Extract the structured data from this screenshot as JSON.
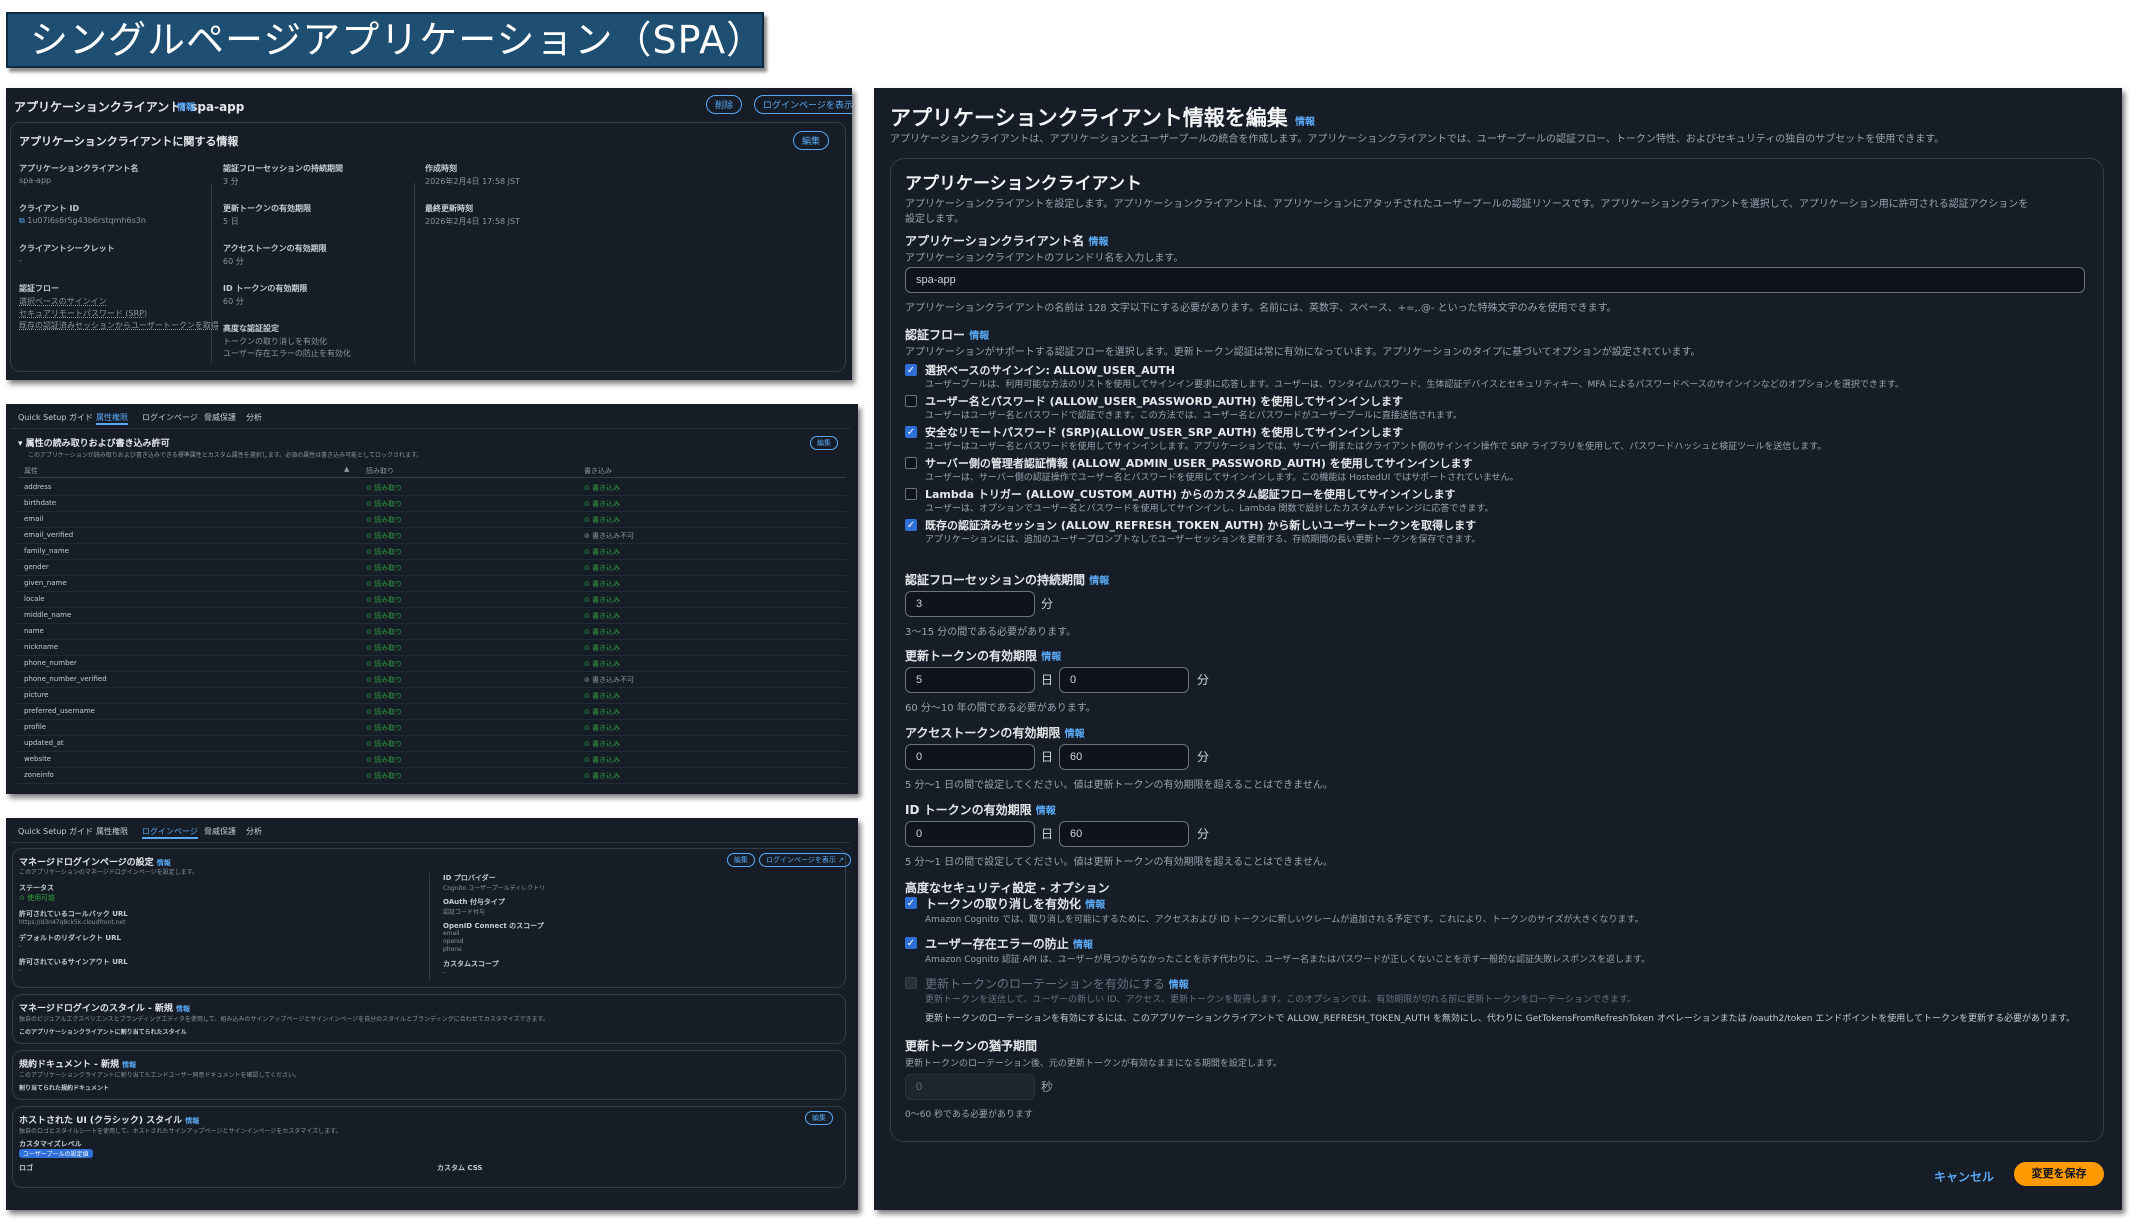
{
  "banner": {
    "title": "シングルページアプリケーション（SPA）"
  },
  "panel1": {
    "header": "アプリケーションクライアント: spa-app",
    "header_info": "情報",
    "delete_button": "削除",
    "view_login_button": "ログインページを表示",
    "section_title": "アプリケーションクライアントに関する情報",
    "edit_button": "編集",
    "col1": [
      {
        "label": "アプリケーションクライアント名",
        "value": "spa-app"
      },
      {
        "label": "クライアント ID",
        "value": "1u07i6s6r5g43b6rstqmh6s3n"
      },
      {
        "label": "クライアントシークレット",
        "value": "-"
      },
      {
        "label": "認証フロー",
        "value": "選択ベースのサインイン"
      },
      {
        "label": "",
        "value": "セキュアリモートパスワード (SRP)"
      },
      {
        "label": "",
        "value": "既存の認証済みセッションからユーザートークンを取得"
      }
    ],
    "col2": [
      {
        "label": "認証フローセッションの持続期間",
        "value": "3 分"
      },
      {
        "label": "更新トークンの有効期限",
        "value": "5 日"
      },
      {
        "label": "アクセストークンの有効期限",
        "value": "60 分"
      },
      {
        "label": "ID トークンの有効期限",
        "value": "60 分"
      },
      {
        "label": "高度な認証設定",
        "value": "トークンの取り消しを有効化"
      },
      {
        "label": "",
        "value": "ユーザー存在エラーの防止を有効化"
      }
    ],
    "col3": [
      {
        "label": "作成時刻",
        "value": "2026年2月4日 17:58 JST"
      },
      {
        "label": "最終更新時刻",
        "value": "2026年2月4日 17:58 JST"
      }
    ]
  },
  "panel2": {
    "tabs": [
      "Quick Setup ガイド",
      "属性権限",
      "ログインページ",
      "脅威保護",
      "分析"
    ],
    "active_tab": 1,
    "section_title": "属性の読み取りおよび書き込み許可",
    "section_desc": "このアプリケーションが読み取りおよび書き込みできる標準属性とカスタム属性を選択します。必須の属性は書き込み可能としてロックされます。",
    "edit_button": "編集",
    "col_headers": [
      "属性",
      "読み取り",
      "書き込み"
    ],
    "rows": [
      [
        "address",
        "読み取り",
        "書き込み"
      ],
      [
        "birthdate",
        "読み取り",
        "書き込み"
      ],
      [
        "email",
        "読み取り",
        "書き込み"
      ],
      [
        "email_verified",
        "読み取り",
        "書き込み不可"
      ],
      [
        "family_name",
        "読み取り",
        "書き込み"
      ],
      [
        "gender",
        "読み取り",
        "書き込み"
      ],
      [
        "given_name",
        "読み取り",
        "書き込み"
      ],
      [
        "locale",
        "読み取り",
        "書き込み"
      ],
      [
        "middle_name",
        "読み取り",
        "書き込み"
      ],
      [
        "name",
        "読み取り",
        "書き込み"
      ],
      [
        "nickname",
        "読み取り",
        "書き込み"
      ],
      [
        "phone_number",
        "読み取り",
        "書き込み"
      ],
      [
        "phone_number_verified",
        "読み取り",
        "書き込み不可"
      ],
      [
        "picture",
        "読み取り",
        "書き込み"
      ],
      [
        "preferred_username",
        "読み取り",
        "書き込み"
      ],
      [
        "profile",
        "読み取り",
        "書き込み"
      ],
      [
        "updated_at",
        "読み取り",
        "書き込み"
      ],
      [
        "website",
        "読み取り",
        "書き込み"
      ],
      [
        "zoneinfo",
        "読み取り",
        "書き込み"
      ]
    ]
  },
  "panel3": {
    "tabs": [
      "Quick Setup ガイド",
      "属性権限",
      "ログインページ",
      "脅威保護",
      "分析"
    ],
    "active_tab": 2,
    "managed_title": "マネージドログインページの設定",
    "managed_desc": "このアプリケーションのマネージドログインページを設定します。",
    "edit_button": "編集",
    "view_login_button": "ログインページを表示",
    "status_label": "ステータス",
    "status_value": "使用可能",
    "idp_label": "ID プロバイダー",
    "idp_value": "Cognito ユーザープールディレクトリ",
    "callback_label": "許可されているコールバック URL",
    "callback_value": "https://d3n47q8ck5k.cloudfront.net",
    "oauth_label": "OAuth 付与タイプ",
    "oauth_value": "認証コード付与",
    "redirect_label": "デフォルトのリダイレクト URL",
    "redirect_value": "-",
    "scopes_label": "OpenID Connect のスコープ",
    "scopes": [
      "email",
      "openid",
      "phone"
    ],
    "signout_label": "許可されているサインアウト URL",
    "signout_value": "-",
    "custom_scope_label": "カスタムスコープ",
    "custom_scope_value": "-",
    "style_title": "マネージドログインのスタイル - 新規",
    "style_desc": "独自のビジュアルエクスペリエンスとブランディングエディタを使用して、組み込みのサインアップページとサインインページを自分のスタイルとブランディングに合わせてカスタマイズできます。",
    "style_note": "このアプリケーションクライアントに割り当てられたスタイル",
    "terms_title": "規約ドキュメント - 新規",
    "terms_desc": "このアプリケーションクライアントに割り当てたエンドユーザー同意ドキュメントを確認してください。",
    "terms_note": "割り当てられた規約ドキュメント",
    "hosted_title": "ホストされた UI (クラシック) スタイル",
    "hosted_desc": "独自のロゴとスタイルシートを使用して、ホストされたサインアップページとサインインページをカスタマイズします。",
    "custom_level_label": "カスタマイズレベル",
    "custom_level_value": "ユーザープールの設定値",
    "logo_label": "ロゴ",
    "css_label": "カスタム CSS"
  },
  "panel4": {
    "title": "アプリケーションクライアント情報を編集",
    "info": "情報",
    "intro": "アプリケーションクライアントは、アプリケーションとユーザープールの統合を作成します。アプリケーションクライアントでは、ユーザープールの認証フロー、トークン特性、およびセキュリティの独自のサブセットを使用できます。",
    "section_title": "アプリケーションクライアント",
    "section_desc1": "アプリケーションクライアントを設定します。アプリケーションクライアントは、アプリケーションにアタッチされたユーザープールの認証リソースです。アプリケーションクライアントを選択して、アプリケーション用に許可される認証アクションを",
    "section_desc2": "設定します。",
    "name_label": "アプリケーションクライアント名",
    "name_desc": "アプリケーションクライアントのフレンドリ名を入力します。",
    "name_value": "spa-app",
    "name_hint": "アプリケーションクライアントの名前は 128 文字以下にする必要があります。名前には、英数字、スペース、+=,.@- といった特殊文字のみを使用できます。",
    "auth_label": "認証フロー",
    "auth_desc": "アプリケーションがサポートする認証フローを選択します。更新トークン認証は常に有効になっています。アプリケーションのタイプに基づいてオプションが設定されています。",
    "flows": [
      {
        "checked": true,
        "title": "選択ベースのサインイン: ALLOW_USER_AUTH",
        "desc": "ユーザープールは、利用可能な方法のリストを使用してサインイン要求に応答します。ユーザーは、ワンタイムパスワード、生体認証デバイスとセキュリティキー、MFA によるパスワードベースのサインインなどのオプションを選択できます。"
      },
      {
        "checked": false,
        "title": "ユーザー名とパスワード (ALLOW_USER_PASSWORD_AUTH) を使用してサインインします",
        "desc": "ユーザーはユーザー名とパスワードで認証できます。この方法では、ユーザー名とパスワードがユーザープールに直接送信されます。"
      },
      {
        "checked": true,
        "title": "安全なリモートパスワード (SRP)(ALLOW_USER_SRP_AUTH) を使用してサインインします",
        "desc": "ユーザーはユーザー名とパスワードを使用してサインインします。アプリケーションでは、サーバー側またはクライアント側のサインイン操作で SRP ライブラリを使用して、パスワードハッシュと検証ツールを送信します。"
      },
      {
        "checked": false,
        "title": "サーバー側の管理者認証情報 (ALLOW_ADMIN_USER_PASSWORD_AUTH) を使用してサインインします",
        "desc": "ユーザーは、サーバー側の認証操作でユーザー名とパスワードを使用してサインインします。この機能は HostedUI ではサポートされていません。"
      },
      {
        "checked": false,
        "title": "Lambda トリガー (ALLOW_CUSTOM_AUTH) からのカスタム認証フローを使用してサインインします",
        "desc": "ユーザーは、オプションでユーザー名とパスワードを使用してサインインし、Lambda 関数で設計したカスタムチャレンジに応答できます。"
      },
      {
        "checked": true,
        "title": "既存の認証済みセッション (ALLOW_REFRESH_TOKEN_AUTH) から新しいユーザートークンを取得します",
        "desc": "アプリケーションには、追加のユーザープロンプトなしでユーザーセッションを更新する、存続期間の長い更新トークンを保存できます。"
      }
    ],
    "session_label": "認証フローセッションの持続期間",
    "session_value": "3",
    "session_unit": "分",
    "session_hint": "3〜15 分の間である必要があります。",
    "refresh_label": "更新トークンの有効期限",
    "refresh_days": "5",
    "refresh_minutes": "0",
    "refresh_hint": "60 分〜10 年の間である必要があります。",
    "access_label": "アクセストークンの有効期限",
    "access_days": "0",
    "access_minutes": "60",
    "access_hint": "5 分〜1 日の間で設定してください。値は更新トークンの有効期限を超えることはできません。",
    "id_label": "ID トークンの有効期限",
    "id_days": "0",
    "id_minutes": "60",
    "id_hint": "5 分〜1 日の間で設定してください。値は更新トークンの有効期限を超えることはできません。",
    "unit_day": "日",
    "unit_min": "分",
    "advanced_label": "高度なセキュリティ設定 - オプション",
    "revoke_title": "トークンの取り消しを有効化",
    "revoke_desc": "Amazon Cognito では、取り消しを可能にするために、アクセスおよび ID トークンに新しいクレームが追加される予定です。これにより、トークンのサイズが大きくなります。",
    "prevent_title": "ユーザー存在エラーの防止",
    "prevent_desc": "Amazon Cognito 認証 API は、ユーザーが見つからなかったことを示す代わりに、ユーザー名またはパスワードが正しくないことを示す一般的な認証失敗レスポンスを返します。",
    "rotation_title": "更新トークンのローテーションを有効にする",
    "rotation_desc": "更新トークンを送信して、ユーザーの新しい ID、アクセス、更新トークンを取得します。このオプションでは、有効期限が切れる前に更新トークンをローテーションできます。",
    "rotation_note": "更新トークンのローテーションを有効にするには、このアプリケーションクライアントで ALLOW_REFRESH_TOKEN_AUTH を無効にし、代わりに GetTokensFromRefreshToken オペレーションまたは /oauth2/token エンドポイントを使用してトークンを更新する必要があります。",
    "grace_label": "更新トークンの猶予期間",
    "grace_desc": "更新トークンのローテーション後、元の更新トークンが有効なままになる期間を設定します。",
    "grace_value": "0",
    "grace_unit": "秒",
    "grace_hint": "0〜60 秒である必要があります",
    "cancel": "キャンセル",
    "save": "変更を保存"
  }
}
